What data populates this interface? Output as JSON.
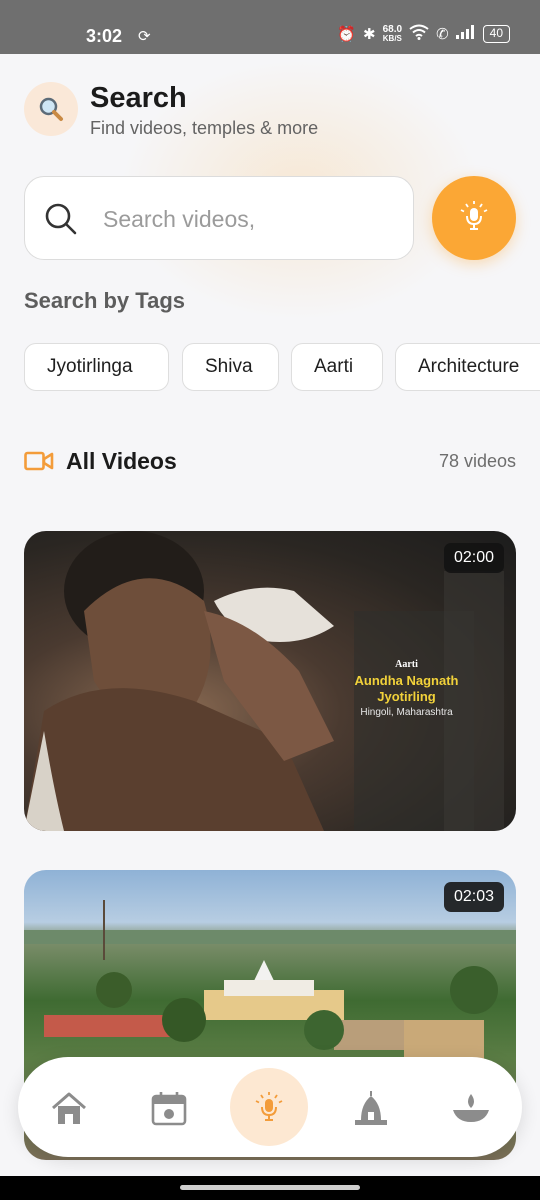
{
  "status_bar": {
    "time": "3:02",
    "net_speed_value": "68.0",
    "net_speed_unit": "KB/S",
    "battery": "40"
  },
  "header": {
    "title": "Search",
    "subtitle": "Find videos, temples & more"
  },
  "search": {
    "placeholder": "Search videos,"
  },
  "tags": {
    "heading": "Search by Tags",
    "items": [
      "Jyotirlinga",
      "Shiva",
      "Aarti",
      "Architecture"
    ]
  },
  "videos": {
    "heading": "All Videos",
    "count": "78 videos",
    "items": [
      {
        "duration": "02:00",
        "overlay_tag": "Aarti",
        "overlay_temple": "Aundha Nagnath Jyotirling",
        "overlay_location": "Hingoli, Maharashtra"
      },
      {
        "duration": "02:03"
      }
    ]
  },
  "bottom_nav": {
    "items": [
      "home-icon",
      "calendar-icon",
      "mic-icon",
      "temple-icon",
      "diya-icon"
    ],
    "active": "mic-icon"
  },
  "colors": {
    "accent": "#FBA735",
    "accent_light": "#FDE8D2",
    "video_icon": "#F39C3A",
    "overlay_highlight": "#F2D23A"
  }
}
